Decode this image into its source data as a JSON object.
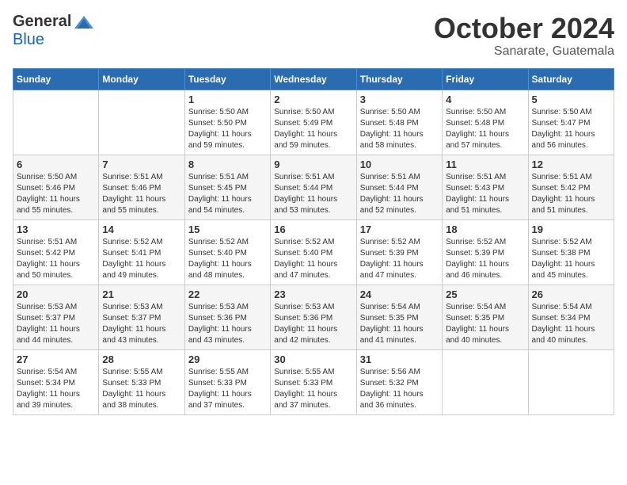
{
  "header": {
    "logo_general": "General",
    "logo_blue": "Blue",
    "month": "October 2024",
    "location": "Sanarate, Guatemala"
  },
  "days_of_week": [
    "Sunday",
    "Monday",
    "Tuesday",
    "Wednesday",
    "Thursday",
    "Friday",
    "Saturday"
  ],
  "weeks": [
    [
      {
        "day": "",
        "info": ""
      },
      {
        "day": "",
        "info": ""
      },
      {
        "day": "1",
        "info": "Sunrise: 5:50 AM\nSunset: 5:50 PM\nDaylight: 11 hours\nand 59 minutes."
      },
      {
        "day": "2",
        "info": "Sunrise: 5:50 AM\nSunset: 5:49 PM\nDaylight: 11 hours\nand 59 minutes."
      },
      {
        "day": "3",
        "info": "Sunrise: 5:50 AM\nSunset: 5:48 PM\nDaylight: 11 hours\nand 58 minutes."
      },
      {
        "day": "4",
        "info": "Sunrise: 5:50 AM\nSunset: 5:48 PM\nDaylight: 11 hours\nand 57 minutes."
      },
      {
        "day": "5",
        "info": "Sunrise: 5:50 AM\nSunset: 5:47 PM\nDaylight: 11 hours\nand 56 minutes."
      }
    ],
    [
      {
        "day": "6",
        "info": "Sunrise: 5:50 AM\nSunset: 5:46 PM\nDaylight: 11 hours\nand 55 minutes."
      },
      {
        "day": "7",
        "info": "Sunrise: 5:51 AM\nSunset: 5:46 PM\nDaylight: 11 hours\nand 55 minutes."
      },
      {
        "day": "8",
        "info": "Sunrise: 5:51 AM\nSunset: 5:45 PM\nDaylight: 11 hours\nand 54 minutes."
      },
      {
        "day": "9",
        "info": "Sunrise: 5:51 AM\nSunset: 5:44 PM\nDaylight: 11 hours\nand 53 minutes."
      },
      {
        "day": "10",
        "info": "Sunrise: 5:51 AM\nSunset: 5:44 PM\nDaylight: 11 hours\nand 52 minutes."
      },
      {
        "day": "11",
        "info": "Sunrise: 5:51 AM\nSunset: 5:43 PM\nDaylight: 11 hours\nand 51 minutes."
      },
      {
        "day": "12",
        "info": "Sunrise: 5:51 AM\nSunset: 5:42 PM\nDaylight: 11 hours\nand 51 minutes."
      }
    ],
    [
      {
        "day": "13",
        "info": "Sunrise: 5:51 AM\nSunset: 5:42 PM\nDaylight: 11 hours\nand 50 minutes."
      },
      {
        "day": "14",
        "info": "Sunrise: 5:52 AM\nSunset: 5:41 PM\nDaylight: 11 hours\nand 49 minutes."
      },
      {
        "day": "15",
        "info": "Sunrise: 5:52 AM\nSunset: 5:40 PM\nDaylight: 11 hours\nand 48 minutes."
      },
      {
        "day": "16",
        "info": "Sunrise: 5:52 AM\nSunset: 5:40 PM\nDaylight: 11 hours\nand 47 minutes."
      },
      {
        "day": "17",
        "info": "Sunrise: 5:52 AM\nSunset: 5:39 PM\nDaylight: 11 hours\nand 47 minutes."
      },
      {
        "day": "18",
        "info": "Sunrise: 5:52 AM\nSunset: 5:39 PM\nDaylight: 11 hours\nand 46 minutes."
      },
      {
        "day": "19",
        "info": "Sunrise: 5:52 AM\nSunset: 5:38 PM\nDaylight: 11 hours\nand 45 minutes."
      }
    ],
    [
      {
        "day": "20",
        "info": "Sunrise: 5:53 AM\nSunset: 5:37 PM\nDaylight: 11 hours\nand 44 minutes."
      },
      {
        "day": "21",
        "info": "Sunrise: 5:53 AM\nSunset: 5:37 PM\nDaylight: 11 hours\nand 43 minutes."
      },
      {
        "day": "22",
        "info": "Sunrise: 5:53 AM\nSunset: 5:36 PM\nDaylight: 11 hours\nand 43 minutes."
      },
      {
        "day": "23",
        "info": "Sunrise: 5:53 AM\nSunset: 5:36 PM\nDaylight: 11 hours\nand 42 minutes."
      },
      {
        "day": "24",
        "info": "Sunrise: 5:54 AM\nSunset: 5:35 PM\nDaylight: 11 hours\nand 41 minutes."
      },
      {
        "day": "25",
        "info": "Sunrise: 5:54 AM\nSunset: 5:35 PM\nDaylight: 11 hours\nand 40 minutes."
      },
      {
        "day": "26",
        "info": "Sunrise: 5:54 AM\nSunset: 5:34 PM\nDaylight: 11 hours\nand 40 minutes."
      }
    ],
    [
      {
        "day": "27",
        "info": "Sunrise: 5:54 AM\nSunset: 5:34 PM\nDaylight: 11 hours\nand 39 minutes."
      },
      {
        "day": "28",
        "info": "Sunrise: 5:55 AM\nSunset: 5:33 PM\nDaylight: 11 hours\nand 38 minutes."
      },
      {
        "day": "29",
        "info": "Sunrise: 5:55 AM\nSunset: 5:33 PM\nDaylight: 11 hours\nand 37 minutes."
      },
      {
        "day": "30",
        "info": "Sunrise: 5:55 AM\nSunset: 5:33 PM\nDaylight: 11 hours\nand 37 minutes."
      },
      {
        "day": "31",
        "info": "Sunrise: 5:56 AM\nSunset: 5:32 PM\nDaylight: 11 hours\nand 36 minutes."
      },
      {
        "day": "",
        "info": ""
      },
      {
        "day": "",
        "info": ""
      }
    ]
  ]
}
